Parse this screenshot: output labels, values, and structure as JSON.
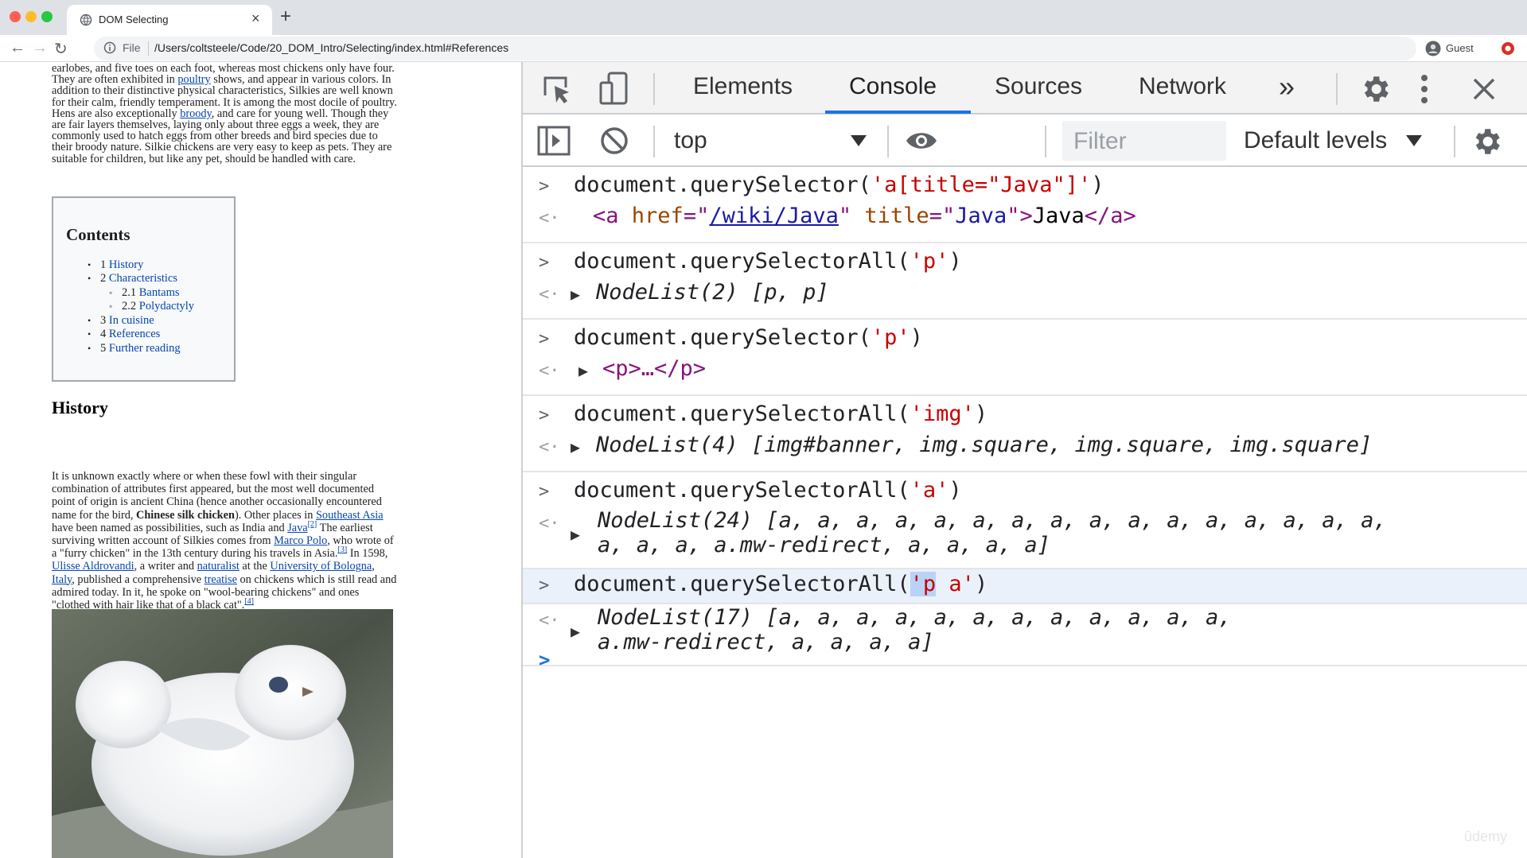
{
  "browser": {
    "tab_title": "DOM Selecting",
    "url_scheme": "File",
    "url": "/Users/coltsteele/Code/20_DOM_Intro/Selecting/index.html#References",
    "profile_name": "Guest",
    "new_tab_symbol": "+",
    "close_symbol": "×"
  },
  "page": {
    "intro_lines": [
      [
        "earlobes, and five toes on each foot, whereas most chickens only have four."
      ],
      [
        "They are often exhibited in ",
        {
          "link": "poultry"
        },
        " shows, and appear in various colors. In"
      ],
      [
        "addition to their distinctive physical characteristics, Silkies are well known"
      ],
      [
        "for their calm, friendly temperament. It is among the most docile of poultry."
      ],
      [
        "Hens are also exceptionally ",
        {
          "link": "broody"
        },
        ", and care for young well. Though they"
      ],
      [
        "are fair layers themselves, laying only about three eggs a week, they are"
      ],
      [
        "commonly used to hatch eggs from other breeds and bird species due to"
      ],
      [
        "their broody nature. Silkie chickens are very easy to keep as pets. They are"
      ],
      [
        "suitable for children, but like any pet, should be handled with care."
      ]
    ],
    "contents_heading": "Contents",
    "toc": [
      {
        "num": "1",
        "text": "History",
        "level": 1
      },
      {
        "num": "2",
        "text": "Characteristics",
        "level": 1
      },
      {
        "num": "2.1",
        "text": "Bantams",
        "level": 2
      },
      {
        "num": "2.2",
        "text": "Polydactyly",
        "level": 2
      },
      {
        "num": "3",
        "text": "In cuisine",
        "level": 1
      },
      {
        "num": "4",
        "text": "References",
        "level": 1
      },
      {
        "num": "5",
        "text": "Further reading",
        "level": 1
      }
    ],
    "history_heading": "History",
    "history_lines": [
      [
        "It is unknown exactly where or when these fowl with their singular"
      ],
      [
        "combination of attributes first appeared, but the most well documented"
      ],
      [
        "point of origin is ancient China (hence another occasionally encountered"
      ],
      [
        "name for the bird, ",
        {
          "bold": "Chinese silk chicken"
        },
        "). Other places in ",
        {
          "link": "Southeast Asia"
        }
      ],
      [
        "have been named as possibilities, such as India and ",
        {
          "link": "Java"
        },
        {
          "sup": "[2]"
        },
        " The earliest"
      ],
      [
        "surviving written account of Silkies comes from ",
        {
          "link": "Marco Polo"
        },
        ", who wrote of"
      ],
      [
        "a \"furry chicken\" in the 13th century during his travels in Asia.",
        {
          "sup": "[3]"
        },
        " In 1598,"
      ],
      [
        {
          "link": "Ulisse Aldrovandi"
        },
        ", a writer and ",
        {
          "link": "naturalist"
        },
        " at the ",
        {
          "link": "University of Bologna"
        },
        ","
      ],
      [
        {
          "link": "Italy"
        },
        ", published a comprehensive ",
        {
          "link": "treatise"
        },
        " on chickens which is still read and"
      ],
      [
        "admired today. In it, he spoke on \"wool-bearing chickens\" and ones"
      ],
      [
        "\"clothed with hair like that of a black cat\".",
        {
          "sup": "[4]"
        }
      ]
    ]
  },
  "devtools": {
    "tabs": [
      "Elements",
      "Console",
      "Sources",
      "Network"
    ],
    "active_tab": "Console",
    "more_tabs": "»",
    "context": "top",
    "filter_placeholder": "Filter",
    "levels": "Default levels",
    "icons": [
      "inspect-icon",
      "device-toggle-icon",
      "settings-icon",
      "kebab-menu-icon",
      "close-icon",
      "sidebar-toggle-icon",
      "clear-console-icon",
      "eye-icon",
      "console-settings-icon"
    ],
    "accent_color": "#1a73e8"
  },
  "console": {
    "entries": [
      {
        "cmd_pre": "document.querySelector(",
        "cmd_str": "'a[title=\"Java\"]'",
        "cmd_post": ")",
        "result_type": "element"
      },
      {
        "cmd_pre": "document.querySelectorAll(",
        "cmd_str": "'p'",
        "cmd_post": ")",
        "result": "NodeList(2) [p, p]"
      },
      {
        "cmd_pre": "document.querySelector(",
        "cmd_str": "'p'",
        "cmd_post": ")",
        "result": "<p>…</p>"
      },
      {
        "cmd_pre": "document.querySelectorAll(",
        "cmd_str": "'img'",
        "cmd_post": ")",
        "result": "NodeList(4) [img#banner, img.square, img.square, img.square]"
      },
      {
        "cmd_pre": "document.querySelectorAll(",
        "cmd_str": "'a'",
        "cmd_post": ")",
        "result_line1": "NodeList(24) [a, a, a, a, a, a, a, a, a, a, a, a, a, a, a, a,",
        "result_line2": "a, a, a, a.mw-redirect, a, a, a, a]"
      },
      {
        "cmd_pre": "document.querySelectorAll(",
        "cmd_str_sel": "'p",
        "cmd_str_rest": " a'",
        "cmd_post": ")",
        "result_line1": "NodeList(17) [a, a, a, a, a, a, a, a, a, a, a, a,",
        "result_line2": "a.mw-redirect, a, a, a, a]"
      }
    ],
    "element_result": {
      "open": "<a ",
      "attr1": "href",
      "val1": "/wiki/Java",
      "attr2": "title",
      "val2": "Java",
      "text": "Java",
      "close": "</a>"
    }
  },
  "watermark": "ûdemy"
}
